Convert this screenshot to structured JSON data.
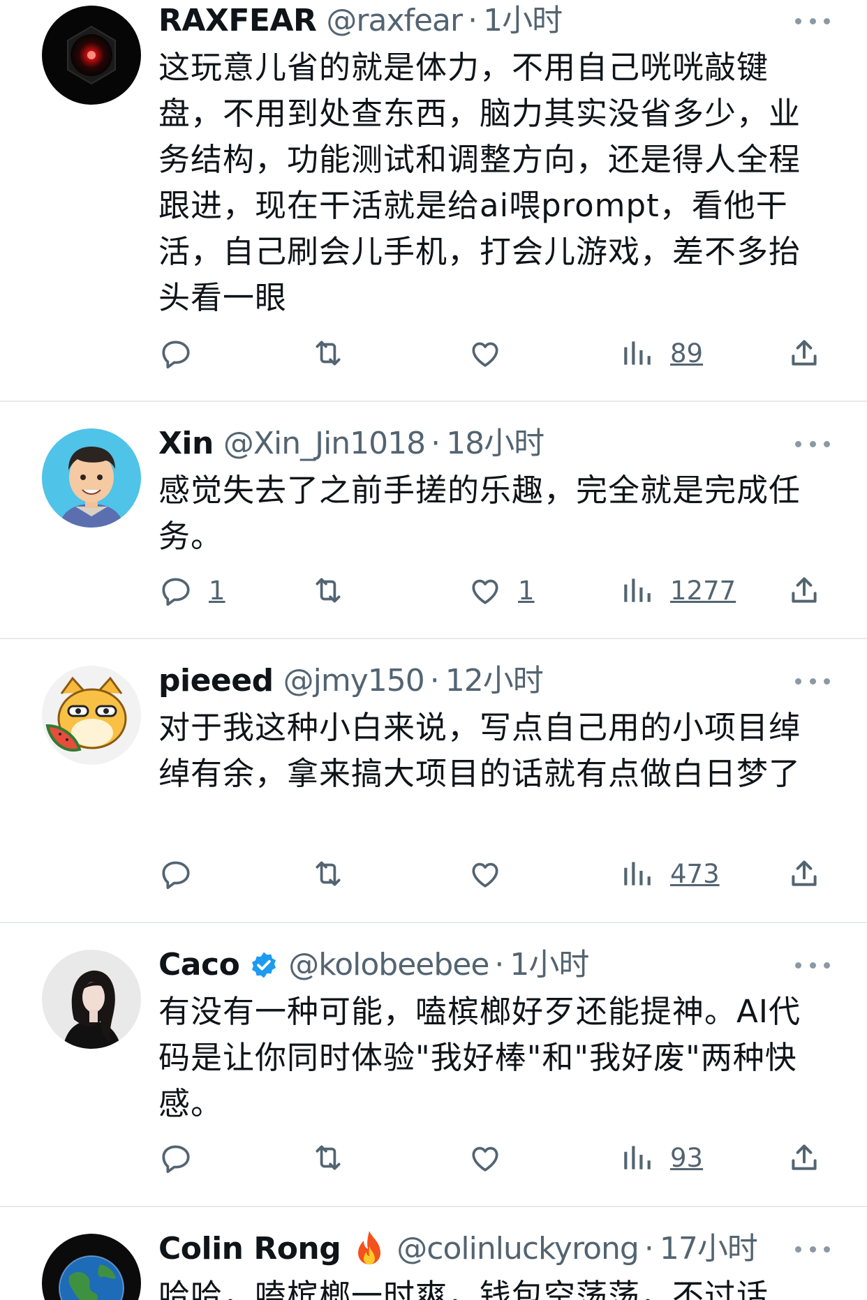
{
  "colors": {
    "text": "#0f1419",
    "secondary": "#536471",
    "divider": "#e7e9eb",
    "verified_badge": "#1d9bf0"
  },
  "tweets": [
    {
      "name": "RAXFEAR",
      "handle": "@raxfear",
      "separator": "·",
      "time": "1小时",
      "text": "这玩意儿省的就是体力，不用自己咣咣敲键盘，不用到处查东西，脑力其实没省多少，业务结构，功能测试和调整方向，还是得人全程跟进，现在干活就是给ai喂prompt，看他干活，自己刷会儿手机，打会儿游戏，差不多抬头看一眼",
      "reply_count": "",
      "like_count": "",
      "view_count": "89",
      "avatar_icon": "red-eye-avatar"
    },
    {
      "name": "Xin",
      "handle": "@Xin_Jin1018",
      "separator": "·",
      "time": "18小时",
      "text": "感觉失去了之前手搓的乐趣，完全就是完成任务。",
      "reply_count": "1",
      "like_count": "1",
      "view_count": "1277",
      "avatar_icon": "cartoon-man-avatar"
    },
    {
      "name": "pieeed",
      "handle": "@jmy150",
      "separator": "·",
      "time": "12小时",
      "text": "对于我这种小白来说，写点自己用的小项目绰绰有余，拿来搞大项目的话就有点做白日梦了",
      "reply_count": "",
      "like_count": "",
      "view_count": "473",
      "avatar_icon": "shiba-dog-avatar"
    },
    {
      "name": "Caco",
      "handle": "@kolobeebee",
      "separator": "·",
      "time": "1小时",
      "text": "有没有一种可能，嗑槟榔好歹还能提神。AI代码是让你同时体验\"我好棒\"和\"我好废\"两种快感。",
      "reply_count": "",
      "like_count": "",
      "view_count": "93",
      "verified": true,
      "avatar_icon": "woman-photo-avatar"
    },
    {
      "name": "Colin Rong",
      "handle": "@colinluckyrong",
      "separator": "·",
      "time": "17小时",
      "text": "哈哈，嗑槟榔一时爽，钱包空荡荡，不过话",
      "emoji": "fire-emoji",
      "avatar_icon": "globe-avatar"
    }
  ]
}
